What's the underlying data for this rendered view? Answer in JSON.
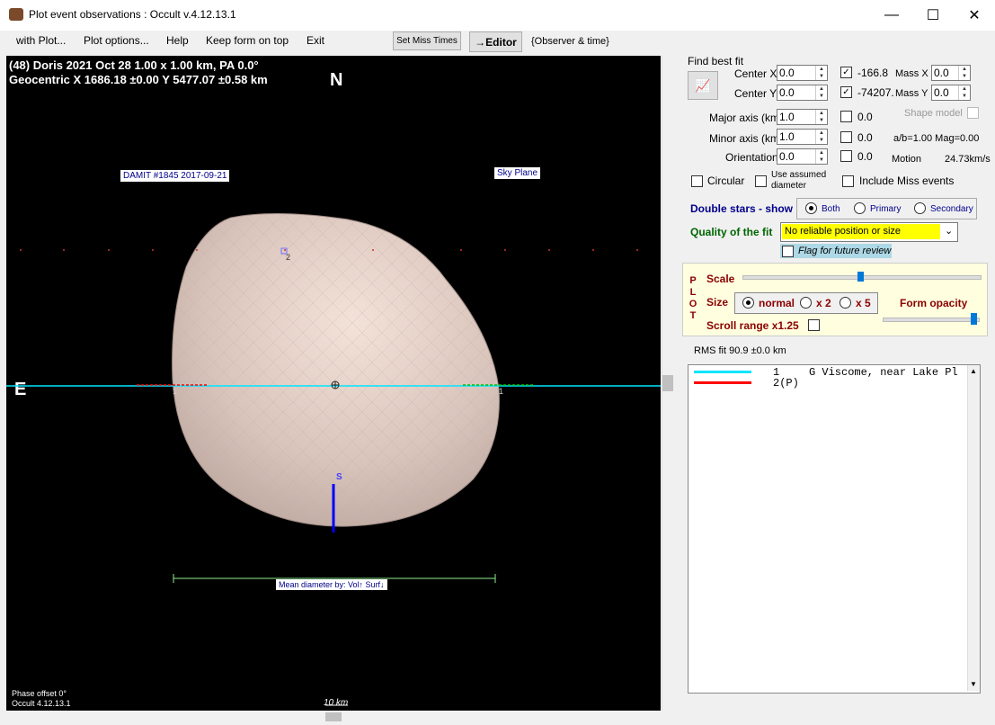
{
  "window": {
    "title": "Plot event observations : Occult v.4.12.13.1",
    "minimize": "—",
    "maximize": "☐",
    "close": "✕"
  },
  "menu": {
    "items": [
      "with Plot...",
      "Plot options...",
      "Help",
      "Keep form on top",
      "Exit"
    ],
    "set_miss_times": "Set Miss Times",
    "editor": "→Editor",
    "observer_time": "{Observer & time}"
  },
  "plot": {
    "header_line1": "(48) Doris  2021 Oct 28   1.00 x 1.00 km,  PA 0.0°",
    "header_line2": "Geocentric  X  1686.18 ±0.00  Y 5477.07 ±0.58 km",
    "north": "N",
    "east": "E",
    "south": "S",
    "damit_label": "DAMIT #1845 2017-09-21",
    "sky_plane": "Sky Plane",
    "chord_label_1a": "1",
    "chord_label_1b": "1",
    "chord_label_2": "2",
    "mean_diameter": "Mean diameter by: Vol↑ Surf↓",
    "scale_text": "10 km",
    "phase_offset": "Phase offset 0°",
    "version": "Occult 4.12.13.1"
  },
  "fit": {
    "find_best_fit": "Find best fit",
    "center_x_label": "Center X",
    "center_x": "0.0",
    "center_y_label": "Center Y",
    "center_y": "0.0",
    "val1": "-166.8",
    "val2": "-74207.",
    "mass_x_label": "Mass X",
    "mass_x": "0.0",
    "mass_y_label": "Mass Y",
    "mass_y": "0.0",
    "major_label": "Major axis (km)",
    "major": "1.0",
    "major_chk": "0.0",
    "minor_label": "Minor axis (km)",
    "minor": "1.0",
    "minor_chk": "0.0",
    "orient_label": "Orientation",
    "orient": "0.0",
    "orient_chk": "0.0",
    "shape_model": "Shape model",
    "ab_mag": "a/b=1.00 Mag=0.00",
    "motion_label": "Motion",
    "motion": "24.73km/s",
    "circular": "Circular",
    "use_assumed": "Use assumed diameter",
    "include_miss": "Include Miss events",
    "double_stars": "Double stars - show",
    "both": "Both",
    "primary": "Primary",
    "secondary": "Secondary",
    "quality_label": "Quality of the fit",
    "quality_value": "No reliable position or size",
    "flag_review": "Flag for future review"
  },
  "plotbox": {
    "plot_letters": [
      "P",
      "L",
      "O",
      "T"
    ],
    "scale": "Scale",
    "size": "Size",
    "normal": "normal",
    "x2": "x 2",
    "x5": "x 5",
    "form_opacity": "Form opacity",
    "scroll_range": "Scroll range x1.25"
  },
  "legend": {
    "rms": "RMS fit 90.9 ±0.0 km",
    "entries": [
      {
        "num": "1",
        "text": "G Viscome, near Lake Pl",
        "color": "#00e5ff"
      },
      {
        "num": "2(P)",
        "text": "",
        "color": "#ff0000"
      }
    ]
  },
  "colors": {
    "plot_bg": "#000000",
    "quality_bg": "#ffff00",
    "chord_cyan": "#00e5ff",
    "chord_red": "#ff0000",
    "south_axis": "#0000ff"
  }
}
